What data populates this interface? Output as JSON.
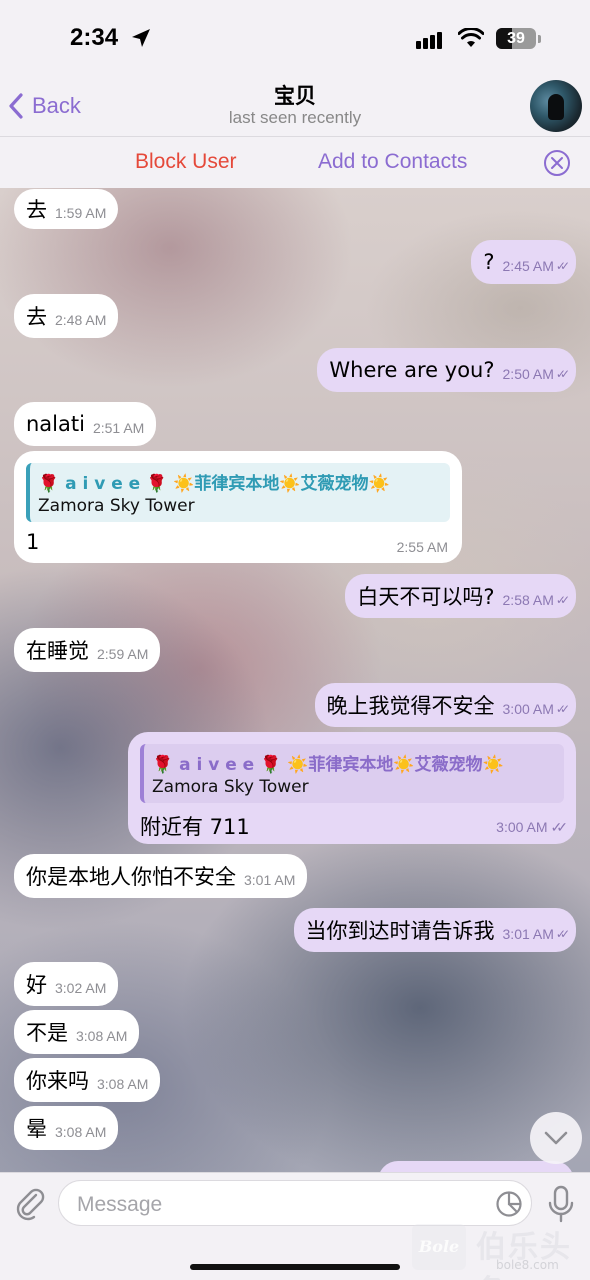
{
  "status_bar": {
    "time": "2:34",
    "battery": "39",
    "battery_level_percent": 39
  },
  "header": {
    "back_label": "Back",
    "contact_name": "宝贝",
    "contact_status": "last seen recently"
  },
  "action_bar": {
    "block_label": "Block User",
    "add_contact_label": "Add to Contacts"
  },
  "messages": [
    {
      "dir": "in",
      "text": "去",
      "time": "1:59 AM"
    },
    {
      "dir": "out",
      "text": "?",
      "time": "2:45 AM"
    },
    {
      "dir": "in",
      "text": "去",
      "time": "2:48 AM"
    },
    {
      "dir": "out",
      "text": "Where are you?",
      "time": "2:50 AM"
    },
    {
      "dir": "in",
      "text": "nalati",
      "time": "2:51 AM"
    },
    {
      "dir": "in",
      "quote_name": "🌹 a i v e e 🌹 ☀️菲律宾本地☀️艾薇宠物☀️",
      "quote_text": "Zamora Sky Tower",
      "text": "1",
      "time": "2:55 AM"
    },
    {
      "dir": "out",
      "text": "白天不可以吗?",
      "time": "2:58 AM"
    },
    {
      "dir": "in",
      "text": "在睡觉",
      "time": "2:59 AM"
    },
    {
      "dir": "out",
      "text": "晚上我觉得不安全",
      "time": "3:00 AM"
    },
    {
      "dir": "out",
      "quote_name": "🌹 a i v e e 🌹 ☀️菲律宾本地☀️艾薇宠物☀️",
      "quote_text": "Zamora Sky Tower",
      "text": "附近有 711",
      "time": "3:00 AM"
    },
    {
      "dir": "in",
      "text": "你是本地人你怕不安全",
      "time": "3:01 AM"
    },
    {
      "dir": "out",
      "text": "当你到达时请告诉我",
      "time": "3:01 AM"
    },
    {
      "dir": "in",
      "text": "好",
      "time": "3:02 AM"
    },
    {
      "dir": "in",
      "text": "不是",
      "time": "3:08 AM"
    },
    {
      "dir": "in",
      "text": "你来吗",
      "time": "3:08 AM"
    },
    {
      "dir": "in",
      "text": "晕",
      "time": "3:08 AM"
    }
  ],
  "input": {
    "placeholder": "Message"
  },
  "watermark": {
    "logo_text": "Bole",
    "title": "伯乐头条",
    "url": "bole8.com"
  },
  "icons": {
    "back": "chevron-left-icon",
    "close": "close-circle-icon",
    "scroll": "chevron-down-icon",
    "attach": "paperclip-icon",
    "sticker": "sticker-icon",
    "mic": "microphone-icon"
  },
  "colors": {
    "accent": "#8b6cd1",
    "block": "#e5493a",
    "outgoing_bubble": "#e6d8f6",
    "incoming_bubble": "#ffffff"
  }
}
